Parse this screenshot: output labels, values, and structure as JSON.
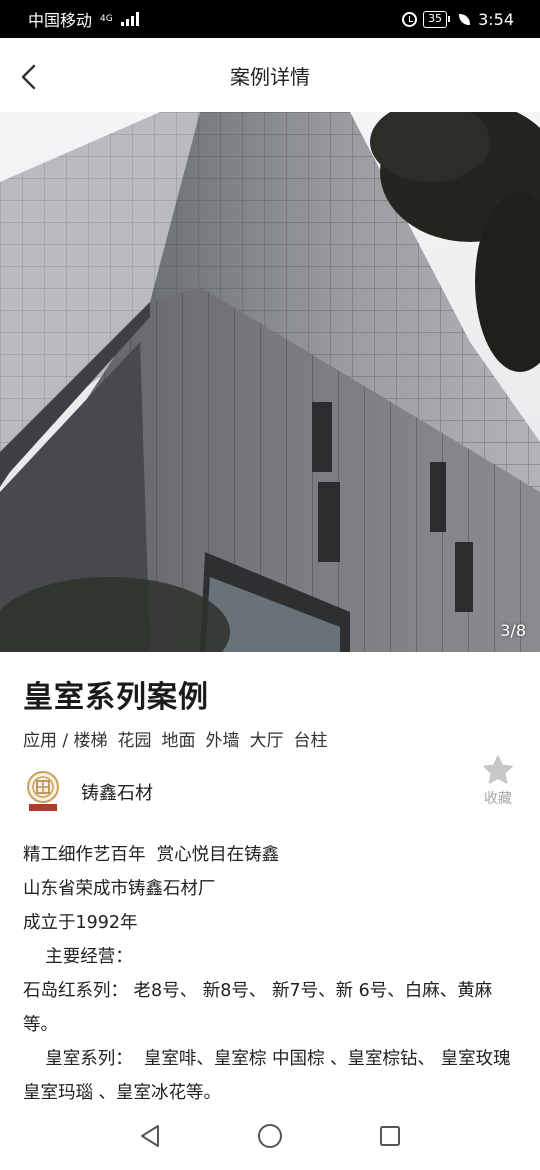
{
  "status_bar": {
    "carrier": "中国移动",
    "network": "4G",
    "battery": "35",
    "time": "3:54"
  },
  "header": {
    "title": "案例详情",
    "back_icon": "chevron-left-icon"
  },
  "gallery": {
    "image_subject": "glass curtain wall office tower with grey stone cladding",
    "indicator": "3/8",
    "current_index": 3,
    "total": 8
  },
  "case": {
    "title": "皇室系列案例",
    "tags": [
      "应用 / 楼梯",
      "花园",
      "地面",
      "外墙",
      "大厅",
      "台柱"
    ]
  },
  "company": {
    "name": "铸鑫石材",
    "logo_icon": "company-logo-icon"
  },
  "favorite": {
    "label": "收藏",
    "icon": "star-icon",
    "color": "#c8c8c8"
  },
  "description": [
    "精工细作艺百年  赏心悦目在铸鑫",
    "山东省荣成市铸鑫石材厂",
    "成立于1992年",
    "    主要经营：",
    "石岛红系列： 老8号、 新8号、 新7号、新 6号、白麻、黄麻等。",
    "    皇室系列：  皇室啡、皇室棕 中国棕 、皇室棕钻、 皇室玫瑰 皇室玛瑙 、皇室冰花等。"
  ],
  "system_nav": {
    "back": "triangle-back-icon",
    "home": "circle-home-icon",
    "recents": "square-recents-icon"
  },
  "colors": {
    "status_bar_bg": "#000000",
    "text_primary": "#222222",
    "text_secondary": "#a6a6a6"
  }
}
